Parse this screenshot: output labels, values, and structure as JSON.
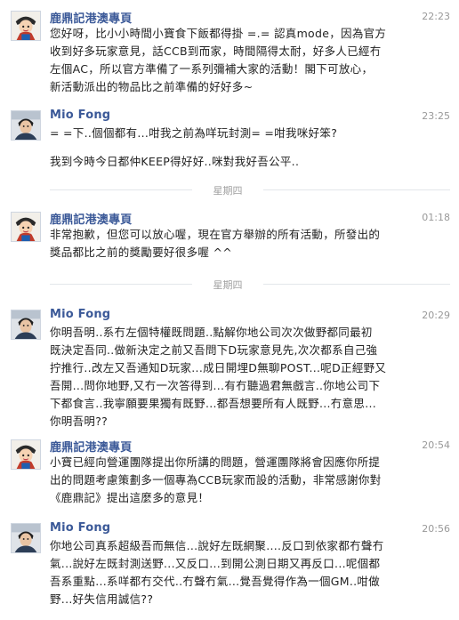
{
  "messages": [
    {
      "sender": "鹿鼎記港澳專頁",
      "time": "22:23",
      "avatar": "character-avatar",
      "lines": [
        "您好呀，比小小時間小寶食下飯都得掛 =.= 認真mode，因為官方",
        "收到好多玩家意見，話CCB到而家，時間隔得太耐，好多人已經冇",
        "左個AC，所以官方準備了一系列彌補大家的活動！閣下可放心，",
        "新活動派出的物品比之前準備的好好多~"
      ]
    },
    {
      "sender": "Mio Fong",
      "time": "23:25",
      "avatar": "user-photo-avatar",
      "lines": [
        "= =下..個個都有...咁我之前為咩玩封測= =咁我咪好笨?",
        "",
        "我到今時今日都仲KEEP得好好..咪對我好吾公平.."
      ]
    },
    {
      "sender": "鹿鼎記港澳專頁",
      "time": "01:18",
      "avatar": "character-avatar",
      "lines": [
        "非常抱歉，但您可以放心喔，現在官方舉辦的所有活動，所發出的",
        "獎品都比之前的獎勵要好很多喔 ^^"
      ]
    },
    {
      "sender": "Mio Fong",
      "time": "20:29",
      "avatar": "user-photo-avatar",
      "lines": [
        "你明吾明..系冇左個特權既問題..點解你地公司次次做野都同最初",
        "既決定吾同..做新決定之前又吾問下D玩家意見先,次次都系自己強",
        "拧推行..改左又吾通知D玩家...成日開埋D無聊POST...呢D正經野又",
        "吾開...問你地野,又冇一次答得到...有冇聽過君無戲言..你地公司下",
        "下都食言..我寧願要果獨有既野...都吾想要所有人既野...冇意思...",
        "你明吾明??"
      ]
    },
    {
      "sender": "鹿鼎記港澳專頁",
      "time": "20:54",
      "avatar": "character-avatar",
      "lines": [
        "小寶已經向營運團隊提出你所講的問題，營運團隊將會因應你所提",
        "出的問題考慮策劃多一個專為CCB玩家而設的活動，非常感謝你對",
        "《鹿鼎記》提出這麼多的意見！"
      ]
    },
    {
      "sender": "Mio Fong",
      "time": "20:56",
      "avatar": "user-photo-avatar",
      "lines": [
        "你地公司真系超級吾而無信...說好左既網聚....反口到依家都冇聲冇",
        "氣...說好左既封測送野...又反口...到開公測日期又再反口...呢個都",
        "吾系重點...系咩都冇交代..冇聲冇氣...覺吾覺得作為一個GM..咁做",
        "野...好失信用誠信??"
      ]
    }
  ],
  "separators": [
    "星期四",
    "星期四"
  ]
}
